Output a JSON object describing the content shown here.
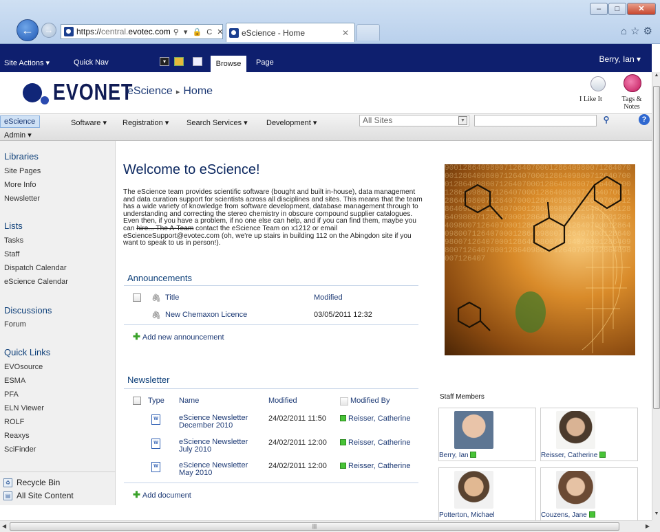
{
  "browser": {
    "url_scheme": "https://",
    "url_host_prefix": "central.",
    "url_domain": "evotec.com",
    "address_icons": "⚲ ▾ 🔒 C ✕",
    "tab_title": "eScience - Home",
    "tab_close": "✕",
    "window_buttons": {
      "minimize": "–",
      "maximize": "□",
      "close": "✕"
    },
    "toolbar_icons": "⌂☆⚙"
  },
  "ribbon": {
    "site_actions": "Site Actions ▾",
    "quick_nav": "Quick Nav",
    "browse_tab": "Browse",
    "page_tab": "Page",
    "user": "Berry, Ian ▾",
    "background_color": "#0e1f6e"
  },
  "title_area": {
    "logo_text": "EVONET",
    "site_title": "eScience",
    "breadcrumb_sep": "▸",
    "page_title": "Home",
    "i_like_it": "I Like It",
    "tags_notes": "Tags & Notes"
  },
  "topnav": {
    "items": [
      "eScience",
      "Software ▾",
      "Registration ▾",
      "Search Services ▾",
      "Development ▾"
    ],
    "admin": "Admin ▾",
    "scope": "All Sites",
    "help": "?"
  },
  "leftnav": {
    "libraries": {
      "heading": "Libraries",
      "items": [
        "Site Pages",
        "More Info",
        "Newsletter"
      ]
    },
    "lists": {
      "heading": "Lists",
      "items": [
        "Tasks",
        "Staff",
        "Dispatch Calendar",
        "eScience Calendar"
      ]
    },
    "discussions": {
      "heading": "Discussions",
      "items": [
        "Forum"
      ]
    },
    "quick_links": {
      "heading": "Quick Links",
      "items": [
        "EVOsource",
        "ESMA",
        "PFA",
        "ELN Viewer",
        "ROLF",
        "Reaxys",
        "SciFinder"
      ]
    },
    "recycle_bin": "Recycle Bin",
    "all_site_content": "All Site Content"
  },
  "welcome": {
    "title": "Welcome to eScience!",
    "text_1": "The eScience team provides scientific software (bought and built in-house), data management and data curation support for scientists across all disciplines and sites. This means that the team has a wide variety of knowledge from software development, database management through to understanding and correcting the stereo chemistry in obscure compound supplier catalogues.  Even then, if you have a problem, if no one else can help, and if you can find them, maybe you can ",
    "text_strike": "hire... The A-Team",
    "text_2": " contact the eScience Team on x1212 or email eScienceSupport@evotec.com (oh, we're up stairs in building 112 on the Abingdon site if you want to speak to us in person!)."
  },
  "announcements": {
    "heading": "Announcements",
    "columns": {
      "title": "Title",
      "modified": "Modified"
    },
    "rows": [
      {
        "title": "New Chemaxon Licence",
        "modified": "03/05/2011 12:32"
      }
    ],
    "add_link": "Add new announcement"
  },
  "newsletter": {
    "heading": "Newsletter",
    "columns": {
      "type": "Type",
      "name": "Name",
      "modified": "Modified",
      "modified_by": "Modified By"
    },
    "rows": [
      {
        "name_1": "eScience Newsletter",
        "name_2": "December 2010",
        "modified": "24/02/2011 11:50",
        "modified_by": "Reisser, Catherine"
      },
      {
        "name_1": "eScience Newsletter",
        "name_2": "July 2010",
        "modified": "24/02/2011 12:00",
        "modified_by": "Reisser, Catherine"
      },
      {
        "name_1": "eScience Newsletter",
        "name_2": "May 2010",
        "modified": "24/02/2011 12:00",
        "modified_by": "Reisser, Catherine"
      }
    ],
    "add_link": "Add document"
  },
  "hero_digits": "9001286409800712640700012864098007126407000128640980071264070001286409800712640700012864098007126407000128640980071264070001286409800712640700012864098007126407000128640980071264070001286409800712640700012864098007126407000128640980071264070001286409800712640700012864098007126407000128640980071264070001286409800712640700012864098007126407000128640980071264070001286409800712640700012864098007126407000128640980071264070001286409800712640700012864098007126407",
  "staff": {
    "title": "Staff Members",
    "members": [
      {
        "name": "Berry, Ian",
        "presence": true
      },
      {
        "name": "Reisser, Catherine",
        "presence": true
      },
      {
        "name": "Potterton, Michael",
        "presence": false
      },
      {
        "name": "Couzens, Jane",
        "presence": true
      }
    ]
  },
  "scrollbar": {
    "grip": "|||"
  }
}
